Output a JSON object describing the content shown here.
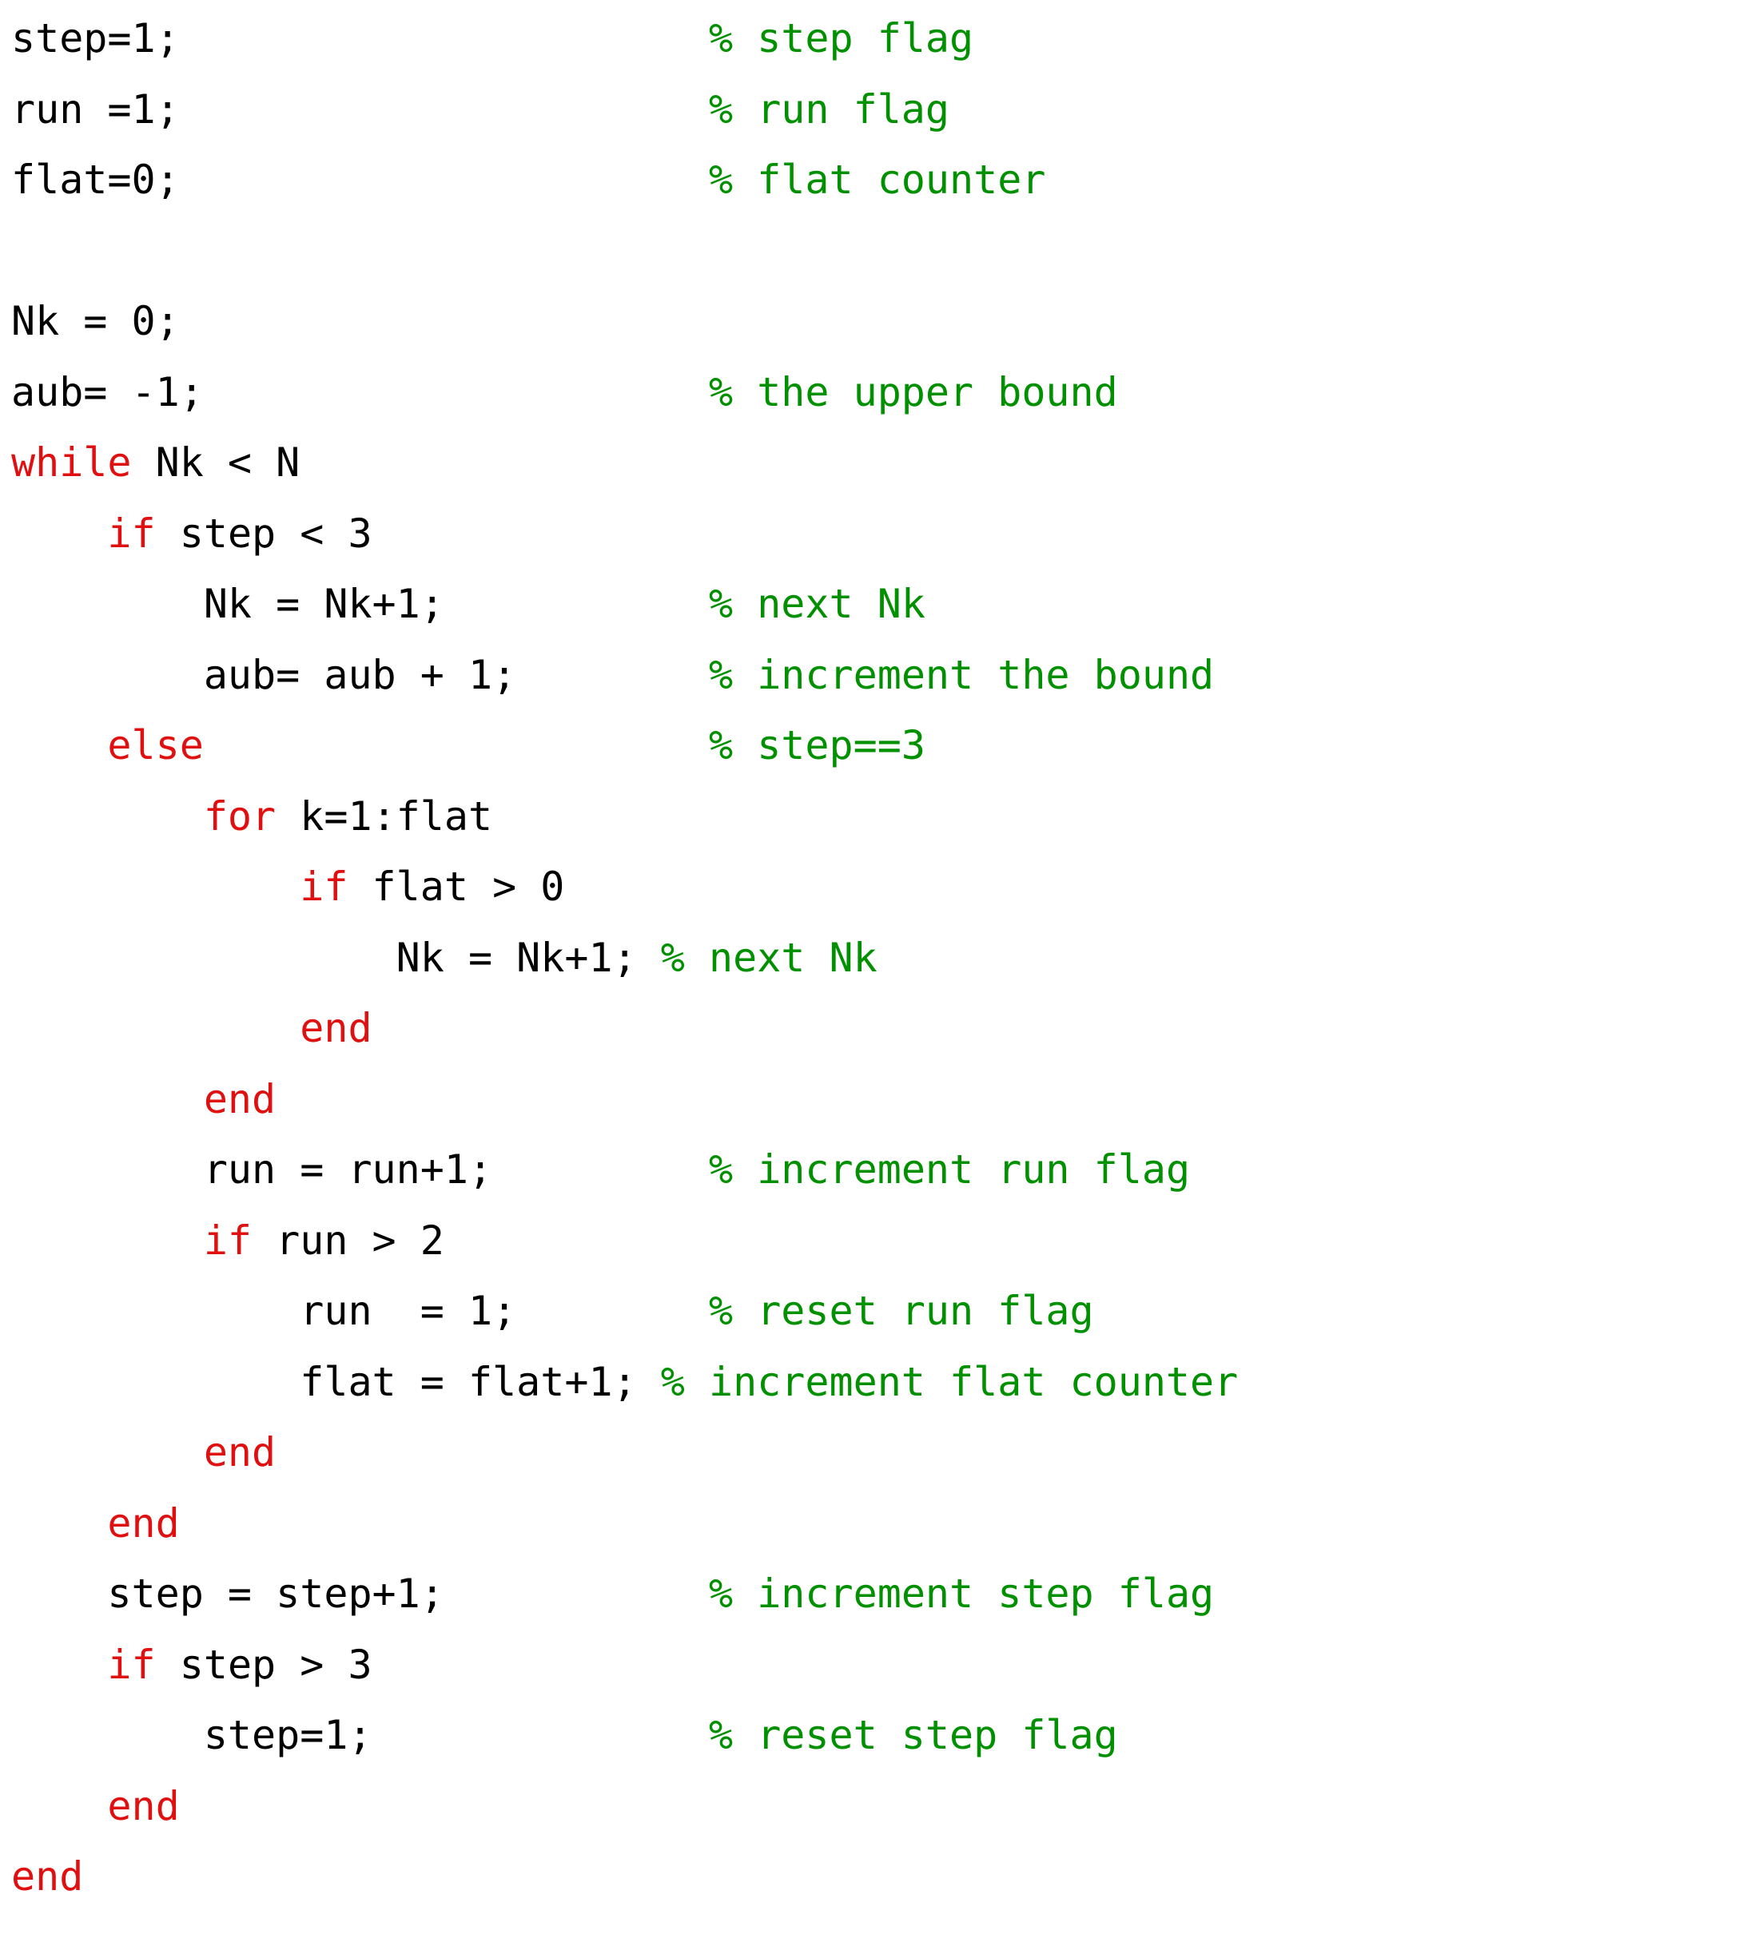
{
  "document": {
    "kind": "matlab-code-listing",
    "language": "MATLAB",
    "background_color": "#ffffff",
    "colors": {
      "code": "#000000",
      "keyword": "#e01010",
      "comment": "#009000"
    },
    "comment_column_chars": 29,
    "line_count": 26
  },
  "lines": [
    {
      "index": 0,
      "text": "step=1;                      % step flag",
      "tokens": [
        {
          "kind": "code",
          "text": "step=1;"
        },
        {
          "kind": "gap",
          "text": "                      "
        },
        {
          "kind": "comment",
          "text": "% step flag"
        }
      ]
    },
    {
      "index": 1,
      "text": "run =1;                      % run flag",
      "tokens": [
        {
          "kind": "code",
          "text": "run =1;"
        },
        {
          "kind": "gap",
          "text": "                      "
        },
        {
          "kind": "comment",
          "text": "% run flag"
        }
      ]
    },
    {
      "index": 2,
      "text": "flat=0;                      % flat counter",
      "tokens": [
        {
          "kind": "code",
          "text": "flat=0;"
        },
        {
          "kind": "gap",
          "text": "                      "
        },
        {
          "kind": "comment",
          "text": "% flat counter"
        }
      ]
    },
    {
      "index": 3,
      "text": "",
      "tokens": []
    },
    {
      "index": 4,
      "text": "Nk = 0;",
      "tokens": [
        {
          "kind": "code",
          "text": "Nk = 0;"
        }
      ]
    },
    {
      "index": 5,
      "text": "aub= -1;                     % the upper bound",
      "tokens": [
        {
          "kind": "code",
          "text": "aub= -1;"
        },
        {
          "kind": "gap",
          "text": "                     "
        },
        {
          "kind": "comment",
          "text": "% the upper bound"
        }
      ]
    },
    {
      "index": 6,
      "text": "while Nk < N",
      "tokens": [
        {
          "kind": "keyword",
          "text": "while"
        },
        {
          "kind": "code",
          "text": " Nk < N"
        }
      ]
    },
    {
      "index": 7,
      "text": "    if step < 3",
      "tokens": [
        {
          "kind": "gap",
          "text": "    "
        },
        {
          "kind": "keyword",
          "text": "if"
        },
        {
          "kind": "code",
          "text": " step < 3"
        }
      ]
    },
    {
      "index": 8,
      "text": "        Nk = Nk+1;           % next Nk",
      "tokens": [
        {
          "kind": "gap",
          "text": "        "
        },
        {
          "kind": "code",
          "text": "Nk = Nk+1;"
        },
        {
          "kind": "gap",
          "text": "           "
        },
        {
          "kind": "comment",
          "text": "% next Nk"
        }
      ]
    },
    {
      "index": 9,
      "text": "        aub= aub + 1;        % increment the bound",
      "tokens": [
        {
          "kind": "gap",
          "text": "        "
        },
        {
          "kind": "code",
          "text": "aub= aub + 1;"
        },
        {
          "kind": "gap",
          "text": "        "
        },
        {
          "kind": "comment",
          "text": "% increment the bound"
        }
      ]
    },
    {
      "index": 10,
      "text": "    else                     % step==3",
      "tokens": [
        {
          "kind": "gap",
          "text": "    "
        },
        {
          "kind": "keyword",
          "text": "else"
        },
        {
          "kind": "gap",
          "text": "                     "
        },
        {
          "kind": "comment",
          "text": "% step==3"
        }
      ]
    },
    {
      "index": 11,
      "text": "        for k=1:flat",
      "tokens": [
        {
          "kind": "gap",
          "text": "        "
        },
        {
          "kind": "keyword",
          "text": "for"
        },
        {
          "kind": "code",
          "text": " k=1:flat"
        }
      ]
    },
    {
      "index": 12,
      "text": "            if flat > 0",
      "tokens": [
        {
          "kind": "gap",
          "text": "            "
        },
        {
          "kind": "keyword",
          "text": "if"
        },
        {
          "kind": "code",
          "text": " flat > 0"
        }
      ]
    },
    {
      "index": 13,
      "text": "                Nk = Nk+1; % next Nk",
      "tokens": [
        {
          "kind": "gap",
          "text": "                "
        },
        {
          "kind": "code",
          "text": "Nk = Nk+1;"
        },
        {
          "kind": "gap",
          "text": " "
        },
        {
          "kind": "comment",
          "text": "% next Nk"
        }
      ]
    },
    {
      "index": 14,
      "text": "            end",
      "tokens": [
        {
          "kind": "gap",
          "text": "            "
        },
        {
          "kind": "keyword",
          "text": "end"
        }
      ]
    },
    {
      "index": 15,
      "text": "        end",
      "tokens": [
        {
          "kind": "gap",
          "text": "        "
        },
        {
          "kind": "keyword",
          "text": "end"
        }
      ]
    },
    {
      "index": 16,
      "text": "        run = run+1;         % increment run flag",
      "tokens": [
        {
          "kind": "gap",
          "text": "        "
        },
        {
          "kind": "code",
          "text": "run = run+1;"
        },
        {
          "kind": "gap",
          "text": "         "
        },
        {
          "kind": "comment",
          "text": "% increment run flag"
        }
      ]
    },
    {
      "index": 17,
      "text": "        if run > 2",
      "tokens": [
        {
          "kind": "gap",
          "text": "        "
        },
        {
          "kind": "keyword",
          "text": "if"
        },
        {
          "kind": "code",
          "text": " run > 2"
        }
      ]
    },
    {
      "index": 18,
      "text": "            run  = 1;        % reset run flag",
      "tokens": [
        {
          "kind": "gap",
          "text": "            "
        },
        {
          "kind": "code",
          "text": "run  = 1;"
        },
        {
          "kind": "gap",
          "text": "        "
        },
        {
          "kind": "comment",
          "text": "% reset run flag"
        }
      ]
    },
    {
      "index": 19,
      "text": "            flat = flat+1; % increment flat counter",
      "tokens": [
        {
          "kind": "gap",
          "text": "            "
        },
        {
          "kind": "code",
          "text": "flat = flat+1;"
        },
        {
          "kind": "gap",
          "text": " "
        },
        {
          "kind": "comment",
          "text": "% increment flat counter"
        }
      ]
    },
    {
      "index": 20,
      "text": "        end",
      "tokens": [
        {
          "kind": "gap",
          "text": "        "
        },
        {
          "kind": "keyword",
          "text": "end"
        }
      ]
    },
    {
      "index": 21,
      "text": "    end",
      "tokens": [
        {
          "kind": "gap",
          "text": "    "
        },
        {
          "kind": "keyword",
          "text": "end"
        }
      ]
    },
    {
      "index": 22,
      "text": "    step = step+1;           % increment step flag",
      "tokens": [
        {
          "kind": "gap",
          "text": "    "
        },
        {
          "kind": "code",
          "text": "step = step+1;"
        },
        {
          "kind": "gap",
          "text": "           "
        },
        {
          "kind": "comment",
          "text": "% increment step flag"
        }
      ]
    },
    {
      "index": 23,
      "text": "    if step > 3",
      "tokens": [
        {
          "kind": "gap",
          "text": "    "
        },
        {
          "kind": "keyword",
          "text": "if"
        },
        {
          "kind": "code",
          "text": " step > 3"
        }
      ]
    },
    {
      "index": 24,
      "text": "        step=1;              % reset step flag",
      "tokens": [
        {
          "kind": "gap",
          "text": "        "
        },
        {
          "kind": "code",
          "text": "step=1;"
        },
        {
          "kind": "gap",
          "text": "              "
        },
        {
          "kind": "comment",
          "text": "% reset step flag"
        }
      ]
    },
    {
      "index": 25,
      "text": "    end",
      "tokens": [
        {
          "kind": "gap",
          "text": "    "
        },
        {
          "kind": "keyword",
          "text": "end"
        }
      ]
    },
    {
      "index": 26,
      "text": "end",
      "tokens": [
        {
          "kind": "keyword",
          "text": "end"
        }
      ]
    }
  ]
}
